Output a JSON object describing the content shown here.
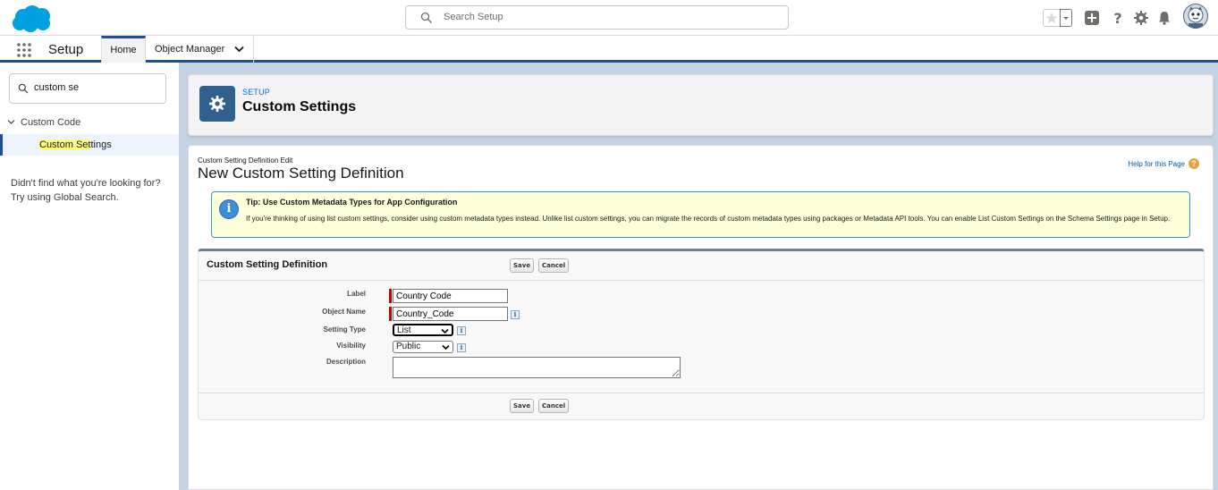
{
  "header": {
    "search_placeholder": "Search Setup"
  },
  "nav": {
    "app_name": "Setup",
    "tabs": [
      {
        "label": "Home"
      },
      {
        "label": "Object Manager"
      }
    ]
  },
  "sidebar": {
    "quick_find_value": "custom se",
    "group_label": "Custom Code",
    "item_highlight": "Custom Set",
    "item_rest": "tings",
    "not_found_text": "Didn't find what you're looking for? Try using Global Search."
  },
  "setup_header": {
    "breadcrumb": "SETUP",
    "title": "Custom Settings"
  },
  "page": {
    "subtitle": "Custom Setting Definition Edit",
    "title": "New Custom Setting Definition",
    "help_link": "Help for this Page"
  },
  "tip": {
    "title": "Tip: Use Custom Metadata Types for App Configuration",
    "body": "If you're thinking of using list custom settings, consider using custom metadata types instead. Unlike list custom settings, you can migrate the records of custom metadata types using packages or Metadata API tools. You can enable List Custom Settings on the Schema Settings page in Setup."
  },
  "form": {
    "section_title": "Custom Setting Definition",
    "save_label": "Save",
    "cancel_label": "Cancel",
    "fields": {
      "label": {
        "label": "Label",
        "value": "Country Code"
      },
      "object_name": {
        "label": "Object Name",
        "value": "Country_Code"
      },
      "setting_type": {
        "label": "Setting Type",
        "value": "List"
      },
      "visibility": {
        "label": "Visibility",
        "value": "Public"
      },
      "description": {
        "label": "Description",
        "value": ""
      }
    }
  },
  "colors": {
    "brand_blue": "#1b5297",
    "link_blue": "#0070d2",
    "tip_background": "#ffffdc",
    "required_red": "#cc0000"
  }
}
